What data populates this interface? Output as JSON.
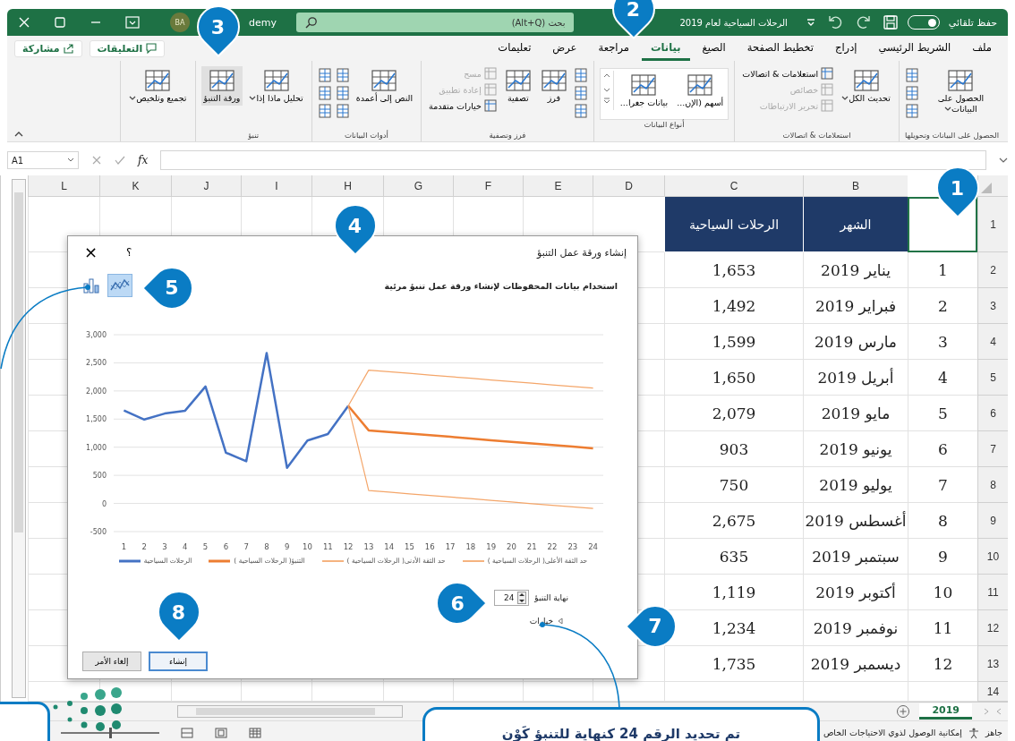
{
  "title_bar": {
    "autosave_label": "حفظ تلقائي",
    "autosave_on": true,
    "file_title": "الرحلات السياحية لعام 2019",
    "search_placeholder": "بحث (Alt+Q)",
    "avatar": "BA",
    "account": "demy"
  },
  "tabs": [
    {
      "label": "ملف",
      "selected": false
    },
    {
      "label": "الشريط الرئيسي",
      "selected": false
    },
    {
      "label": "إدراج",
      "selected": false
    },
    {
      "label": "تخطيط الصفحة",
      "selected": false
    },
    {
      "label": "الصيغ",
      "selected": false
    },
    {
      "label": "بيانات",
      "selected": true
    },
    {
      "label": "مراجعة",
      "selected": false
    },
    {
      "label": "عرض",
      "selected": false
    },
    {
      "label": "تعليمات",
      "selected": false
    }
  ],
  "tab_buttons": [
    "التعليقات",
    "مشاركة"
  ],
  "ribbon": [
    {
      "label": "الحصول على البيانات وتحويلها",
      "items": [
        {
          "kind": "large",
          "label": "الحصول على البيانات",
          "dropdown": true,
          "highlighted": false
        },
        {
          "kind": "icons"
        }
      ]
    },
    {
      "label": "استعلامات & اتصالات",
      "items": [
        {
          "kind": "large",
          "label": "تحديث الكل",
          "dropdown": true,
          "highlighted": false
        },
        {
          "kind": "stack",
          "items": [
            {
              "label": "استعلامات & اتصالات",
              "disabled": false
            },
            {
              "label": "خصائص",
              "disabled": true
            },
            {
              "label": "تحرير الارتباطات",
              "disabled": true
            }
          ]
        }
      ]
    },
    {
      "label": "أنواع البيانات",
      "gallery": true,
      "items": [
        {
          "kind": "large",
          "label": "أسهم (الإن...",
          "dropdown": false,
          "highlighted": false
        },
        {
          "kind": "large",
          "label": "بيانات جغرا...",
          "dropdown": false,
          "highlighted": false
        }
      ]
    },
    {
      "label": "فرز وتصفية",
      "items": [
        {
          "kind": "icons"
        },
        {
          "kind": "large",
          "label": "فرز",
          "dropdown": false,
          "highlighted": false
        },
        {
          "kind": "large",
          "label": "تصفية",
          "dropdown": false,
          "highlighted": false
        },
        {
          "kind": "stack",
          "items": [
            {
              "label": "مسح",
              "disabled": true
            },
            {
              "label": "إعادة تطبيق",
              "disabled": true
            },
            {
              "label": "خيارات متقدمة",
              "disabled": false
            }
          ]
        }
      ]
    },
    {
      "label": "أدوات البيانات",
      "items": [
        {
          "kind": "large",
          "label": "النص إلى أعمدة",
          "dropdown": false,
          "highlighted": false
        },
        {
          "kind": "icons"
        },
        {
          "kind": "icons"
        }
      ]
    },
    {
      "label": "تنبؤ",
      "items": [
        {
          "kind": "large",
          "label": "تحليل ماذا إذا",
          "dropdown": true,
          "highlighted": false
        },
        {
          "kind": "large",
          "label": "ورقة التنبؤ",
          "dropdown": false,
          "highlighted": true
        }
      ]
    },
    {
      "items": [
        {
          "kind": "large",
          "label": "تجميع وتلخيص",
          "dropdown": true,
          "highlighted": false
        }
      ]
    }
  ],
  "formula_bar": {
    "name_box": "A1",
    "function_symbol": "fx"
  },
  "sheet": {
    "columns": [
      "B",
      "C",
      "D",
      "E",
      "F",
      "G",
      "H",
      "I",
      "J",
      "K",
      "L"
    ],
    "header_row": {
      "number": "1",
      "a1_selected": true,
      "cells": [
        "الشهر",
        "الرحلات السياحية"
      ]
    },
    "rows": [
      {
        "number": "2",
        "index": "1",
        "month": "يناير 2019",
        "trips": "1,653"
      },
      {
        "number": "3",
        "index": "2",
        "month": "فبراير 2019",
        "trips": "1,492"
      },
      {
        "number": "4",
        "index": "3",
        "month": "مارس 2019",
        "trips": "1,599"
      },
      {
        "number": "5",
        "index": "4",
        "month": "أبريل 2019",
        "trips": "1,650"
      },
      {
        "number": "6",
        "index": "5",
        "month": "مايو 2019",
        "trips": "2,079"
      },
      {
        "number": "7",
        "index": "6",
        "month": "يونيو 2019",
        "trips": "903"
      },
      {
        "number": "8",
        "index": "7",
        "month": "يوليو 2019",
        "trips": "750"
      },
      {
        "number": "9",
        "index": "8",
        "month": "أغسطس 2019",
        "trips": "2,675"
      },
      {
        "number": "10",
        "index": "9",
        "month": "سبتمبر 2019",
        "trips": "635"
      },
      {
        "number": "11",
        "index": "10",
        "month": "أكتوبر 2019",
        "trips": "1,119"
      },
      {
        "number": "12",
        "index": "11",
        "month": "نوفمبر 2019",
        "trips": "1,234"
      },
      {
        "number": "13",
        "index": "12",
        "month": "ديسمبر 2019",
        "trips": "1,735"
      }
    ],
    "empty_rows": [
      "14"
    ]
  },
  "dialog": {
    "title": "إنشاء ورقة عمل التنبؤ",
    "help": "؟",
    "close": "×",
    "description": "استخدام بيانات المحفوظات لإنشاء ورقة عمل تنبؤ مرئية",
    "chart_types": [
      {
        "kind": "line",
        "selected": true
      },
      {
        "kind": "column",
        "selected": false
      }
    ],
    "chart_data": {
      "type": "line",
      "grid": true,
      "legend": "bottom",
      "xlim": [
        0.5,
        24.5
      ],
      "x": [
        1,
        2,
        3,
        4,
        5,
        6,
        7,
        8,
        9,
        10,
        11,
        12,
        13,
        14,
        15,
        16,
        17,
        18,
        19,
        20,
        21,
        22,
        23,
        24
      ],
      "ylim": [
        -500,
        3000
      ],
      "yticks": [
        {
          "value": -500,
          "label": "-500"
        },
        {
          "value": 0,
          "label": "0"
        },
        {
          "value": 500,
          "label": "500"
        },
        {
          "value": 1000,
          "label": "1,000"
        },
        {
          "value": 1500,
          "label": "1,500"
        },
        {
          "value": 2000,
          "label": "2,000"
        },
        {
          "value": 2500,
          "label": "2,500"
        },
        {
          "value": 3000,
          "label": "3,000"
        }
      ],
      "xticks": [
        1,
        2,
        3,
        4,
        5,
        6,
        7,
        8,
        9,
        10,
        11,
        12,
        13,
        14,
        15,
        16,
        17,
        18,
        19,
        20,
        21,
        22,
        23,
        24
      ],
      "series": [
        {
          "name": "الرحلات السياحية",
          "color": "#4472c4",
          "values": [
            1653,
            1492,
            1599,
            1650,
            2079,
            903,
            750,
            2675,
            635,
            1119,
            1234,
            1735,
            null,
            null,
            null,
            null,
            null,
            null,
            null,
            null,
            null,
            null,
            null,
            null
          ]
        },
        {
          "name": "التنبؤ( الرحلات السياحية )",
          "color": "#ed7d31",
          "values": [
            null,
            null,
            null,
            null,
            null,
            null,
            null,
            null,
            null,
            null,
            null,
            1735,
            1300,
            1271,
            1242,
            1213,
            1184,
            1155,
            1125,
            1096,
            1067,
            1038,
            1009,
            980
          ]
        },
        {
          "name": "حد الثقة الأدنى( الرحلات السياحية )",
          "color": "#f4a66a",
          "values": [
            null,
            null,
            null,
            null,
            null,
            null,
            null,
            null,
            null,
            null,
            null,
            1735,
            230,
            201,
            172,
            143,
            114,
            85,
            55,
            26,
            -3,
            -32,
            -61,
            -90
          ]
        },
        {
          "name": "حد الثقة الأعلى( الرحلات السياحية )",
          "color": "#f4a66a",
          "values": [
            null,
            null,
            null,
            null,
            null,
            null,
            null,
            null,
            null,
            null,
            null,
            1735,
            2370,
            2341,
            2312,
            2283,
            2254,
            2225,
            2195,
            2166,
            2137,
            2108,
            2079,
            2050
          ]
        }
      ]
    },
    "forecast_end_label": "نهاية التنبؤ",
    "forecast_end_value": "24",
    "options_label": "خيارات",
    "buttons": [
      {
        "label": "إنشاء",
        "primary": true
      },
      {
        "label": "إلغاء الأمر",
        "primary": false
      }
    ]
  },
  "sheet_tabs": [
    {
      "label": "2019",
      "selected": true
    }
  ],
  "status_bar": {
    "ready": "جاهز",
    "accessibility": "إمكانية الوصول لذوي الاحتياجات الخاص",
    "zoom": {
      "level": 0.5
    }
  },
  "callouts": [
    "1",
    "2",
    "3",
    "4",
    "5",
    "6",
    "7",
    "8"
  ],
  "note": "تم تحديد الرقم 24 كنهاية للتنبؤ كَوْن"
}
